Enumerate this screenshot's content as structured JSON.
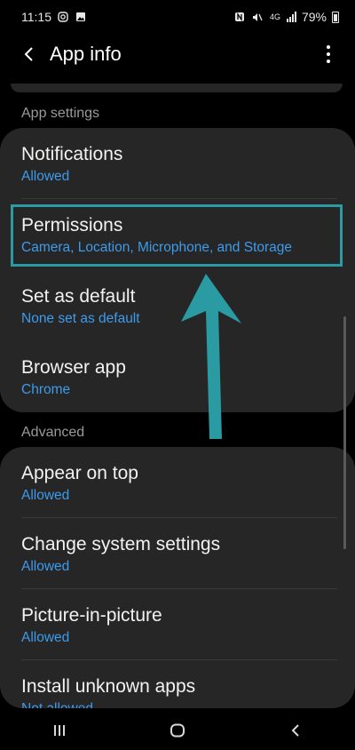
{
  "status_bar": {
    "time": "11:15",
    "battery_percent": "79%",
    "icons": [
      "instagram-icon",
      "image-icon",
      "nfc-icon",
      "mute-icon",
      "4g-icon",
      "signal-icon",
      "battery-icon"
    ]
  },
  "header": {
    "title": "App info"
  },
  "sections": {
    "app_settings_label": "App settings",
    "advanced_label": "Advanced"
  },
  "app_settings": [
    {
      "title": "Notifications",
      "subtitle": "Allowed"
    },
    {
      "title": "Permissions",
      "subtitle": "Camera, Location, Microphone, and Storage"
    },
    {
      "title": "Set as default",
      "subtitle": "None set as default"
    },
    {
      "title": "Browser app",
      "subtitle": "Chrome"
    }
  ],
  "advanced": [
    {
      "title": "Appear on top",
      "subtitle": "Allowed"
    },
    {
      "title": "Change system settings",
      "subtitle": "Allowed"
    },
    {
      "title": "Picture-in-picture",
      "subtitle": "Allowed"
    },
    {
      "title": "Install unknown apps",
      "subtitle": "Not allowed"
    }
  ],
  "colors": {
    "accent_blue": "#3d9bec",
    "highlight_teal": "#2a9aa3",
    "card_bg": "#262626"
  }
}
